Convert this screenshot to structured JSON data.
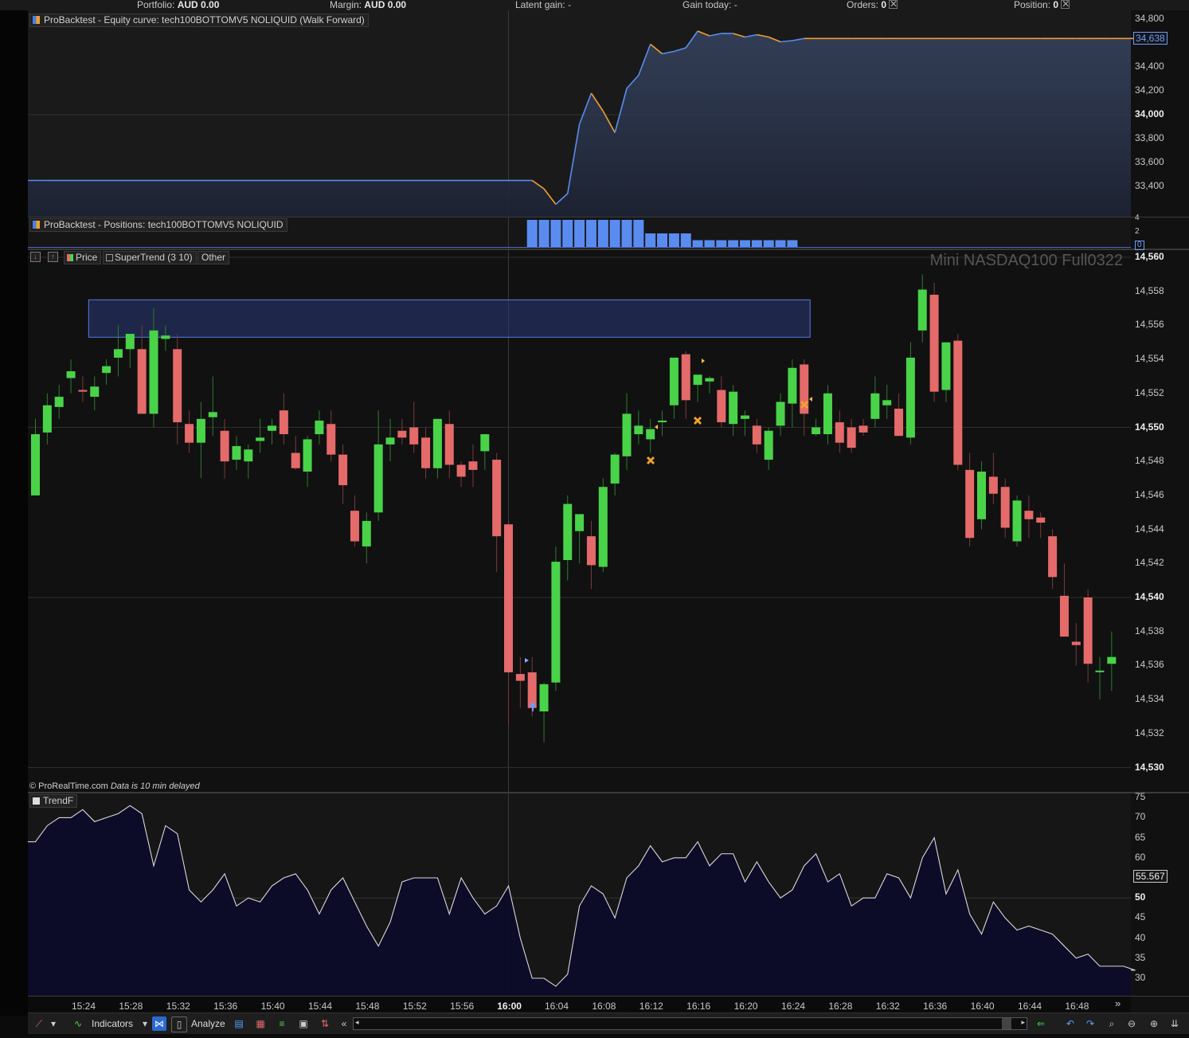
{
  "status_bar": {
    "portfolio_label": "Portfolio:",
    "portfolio_value": "AUD 0.00",
    "margin_label": "Margin:",
    "margin_value": "AUD 0.00",
    "latent_label": "Latent gain:",
    "latent_value": "-",
    "gain_today_label": "Gain today:",
    "gain_today_value": "-",
    "orders_label": "Orders:",
    "orders_value": "0",
    "position_label": "Position:",
    "position_value": "0"
  },
  "equity_panel": {
    "label": "ProBacktest - Equity curve: tech100BOTTOMV5 NOLIQUID (Walk Forward)",
    "axis_ticks": [
      "34,800",
      "34,638",
      "34,400",
      "34,200",
      "34,000",
      "33,800",
      "33,600",
      "33,400"
    ],
    "bold_tick": "34,000",
    "current_value": "34,638"
  },
  "positions_panel": {
    "label": "ProBacktest - Positions: tech100BOTTOMV5 NOLIQUID",
    "axis_ticks": [
      "4",
      "2",
      "0"
    ],
    "current_value": "0"
  },
  "price_panel": {
    "price_tag": "Price",
    "supertrend_tag": "SuperTrend (3 10)",
    "other_tag": "Other",
    "instrument": "Mini NASDAQ100 Full0322",
    "copyright": "© ProRealTime.com",
    "delay_note": "Data is 10 min delayed",
    "axis_ticks": [
      "14,560",
      "14,558",
      "14,556",
      "14,554",
      "14,552",
      "14,550",
      "14,548",
      "14,546",
      "14,544",
      "14,542",
      "14,540",
      "14,538",
      "14,536",
      "14,534",
      "14,532",
      "14,530"
    ],
    "bold_ticks": [
      "14,560",
      "14,550",
      "14,540",
      "14,530"
    ]
  },
  "trend_panel": {
    "label": "TrendF",
    "axis_ticks": [
      "75",
      "70",
      "65",
      "60",
      "55",
      "50",
      "45",
      "40",
      "35",
      "30"
    ],
    "bold_tick": "50",
    "current_value": "55.567"
  },
  "time_axis": {
    "labels": [
      "15:24",
      "15:28",
      "15:32",
      "15:36",
      "15:40",
      "15:44",
      "15:48",
      "15:52",
      "15:56",
      "16:00",
      "16:04",
      "16:08",
      "16:12",
      "16:16",
      "16:20",
      "16:24",
      "16:28",
      "16:32",
      "16:36",
      "16:40",
      "16:44",
      "16:48"
    ],
    "bold_label": "16:00"
  },
  "toolbar": {
    "indicators_label": "Indicators",
    "analyze_label": "Analyze"
  },
  "colors": {
    "bull": "#49d349",
    "bear": "#e56a6a",
    "equity_line": "#5a8cf0",
    "equity_flat": "#f0a030",
    "positions_bar": "#5a8cf0",
    "trend_line": "#d8d8d8",
    "zone": "#2a3a78"
  },
  "chart_data": [
    {
      "type": "line",
      "name": "equity_curve",
      "x_index": [
        0,
        1,
        2,
        3,
        4,
        5,
        6,
        7,
        8,
        9,
        10,
        11,
        12,
        13,
        14,
        15,
        16,
        17,
        18,
        19,
        20,
        21,
        22,
        23,
        24,
        25,
        26,
        27,
        28,
        29,
        30,
        31,
        32,
        33,
        34,
        35,
        36,
        37,
        38,
        39,
        40,
        41,
        42,
        43,
        44,
        45,
        46,
        47,
        48,
        49,
        50,
        51,
        52,
        53,
        54,
        55,
        56,
        57,
        58,
        59,
        60,
        61,
        62,
        63,
        64,
        65,
        66,
        67,
        68,
        69,
        70,
        71,
        72,
        73,
        74,
        75,
        76,
        77,
        78,
        79,
        80,
        81,
        82,
        83,
        84,
        85,
        86,
        87,
        88,
        89,
        90,
        91,
        92,
        93
      ],
      "values": [
        33450,
        33450,
        33450,
        33450,
        33450,
        33450,
        33450,
        33450,
        33450,
        33450,
        33450,
        33450,
        33450,
        33450,
        33450,
        33450,
        33450,
        33450,
        33450,
        33450,
        33450,
        33450,
        33450,
        33450,
        33450,
        33450,
        33450,
        33450,
        33450,
        33450,
        33450,
        33450,
        33450,
        33450,
        33450,
        33450,
        33450,
        33450,
        33450,
        33450,
        33450,
        33450,
        33450,
        33380,
        33250,
        33340,
        33920,
        34180,
        34030,
        33850,
        34220,
        34330,
        34590,
        34510,
        34530,
        34560,
        34700,
        34660,
        34680,
        34680,
        34650,
        34670,
        34650,
        34610,
        34620,
        34638,
        34638,
        34638,
        34638,
        34638,
        34638,
        34638,
        34638,
        34638,
        34638,
        34638,
        34638,
        34638,
        34638,
        34638,
        34638,
        34638,
        34638,
        34638,
        34638,
        34638,
        34638,
        34638,
        34638,
        34638,
        34638,
        34638,
        34638,
        34638
      ],
      "ylim": [
        33200,
        34800
      ]
    },
    {
      "type": "bar",
      "name": "positions",
      "x_index": [
        42,
        43,
        44,
        45,
        46,
        47,
        48,
        49,
        50,
        51,
        52,
        53,
        54,
        55,
        56,
        57,
        58,
        59,
        60,
        61,
        62,
        63,
        64
      ],
      "values": [
        4,
        4,
        4,
        4,
        4,
        4,
        4,
        4,
        4,
        4,
        2,
        2,
        2,
        2,
        1,
        1,
        1,
        1,
        1,
        1,
        1,
        1,
        1
      ],
      "ylim": [
        0,
        4
      ]
    },
    {
      "type": "candlestick",
      "name": "price",
      "ylim": [
        14529.5,
        14560.5
      ],
      "ohlc": [
        [
          14546,
          14550.5,
          14546,
          14549.6
        ],
        [
          14549.7,
          14552,
          14549,
          14551.3
        ],
        [
          14551.2,
          14552.5,
          14550.5,
          14551.8
        ],
        [
          14552.9,
          14554,
          14552,
          14553.3
        ],
        [
          14552.2,
          14553,
          14551.5,
          14552.1
        ],
        [
          14551.8,
          14553,
          14551,
          14552.4
        ],
        [
          14553.2,
          14554,
          14552.5,
          14553.6
        ],
        [
          14554.1,
          14556,
          14553,
          14554.6
        ],
        [
          14554.6,
          14555.5,
          14553.5,
          14555.5
        ],
        [
          14554.6,
          14556,
          14551.5,
          14550.8
        ],
        [
          14550.8,
          14557,
          14550,
          14555.7
        ],
        [
          14555.2,
          14556,
          14554.5,
          14555.4
        ],
        [
          14554.6,
          14555.5,
          14549,
          14550.3
        ],
        [
          14550.2,
          14551,
          14548.5,
          14549.1
        ],
        [
          14549.1,
          14551.5,
          14547,
          14550.5
        ],
        [
          14550.6,
          14553,
          14549.5,
          14550.9
        ],
        [
          14549.8,
          14550.5,
          14547,
          14548
        ],
        [
          14548.1,
          14549.5,
          14547.5,
          14548.9
        ],
        [
          14548,
          14549,
          14547,
          14548.7
        ],
        [
          14549.2,
          14550.5,
          14548.5,
          14549.4
        ],
        [
          14549.8,
          14550.5,
          14549,
          14550.1
        ],
        [
          14551,
          14552,
          14549,
          14549.6
        ],
        [
          14548.5,
          14549.5,
          14547.5,
          14547.6
        ],
        [
          14547.4,
          14549.5,
          14546.5,
          14549.3
        ],
        [
          14549.6,
          14551,
          14549,
          14550.4
        ],
        [
          14550.2,
          14551,
          14548,
          14548.4
        ],
        [
          14548.4,
          14549,
          14545.5,
          14546.6
        ],
        [
          14545.1,
          14546,
          14543,
          14543.3
        ],
        [
          14543,
          14545,
          14542,
          14544.5
        ],
        [
          14545,
          14551,
          14544.5,
          14549
        ],
        [
          14549,
          14550.5,
          14548,
          14549.4
        ],
        [
          14549.8,
          14550.5,
          14549,
          14549.4
        ],
        [
          14550,
          14551.5,
          14548.5,
          14549
        ],
        [
          14549.4,
          14550,
          14547,
          14547.6
        ],
        [
          14547.6,
          14550.5,
          14547,
          14550.5
        ],
        [
          14550.2,
          14551,
          14547,
          14547.8
        ],
        [
          14547.8,
          14548,
          14546.5,
          14547.1
        ],
        [
          14548,
          14549,
          14546.5,
          14547.5
        ],
        [
          14548.6,
          14549.5,
          14547.5,
          14549.6
        ],
        [
          14548.1,
          14548.5,
          14541.5,
          14543.6
        ],
        [
          14544.3,
          14544.5,
          14532.5,
          14535.6
        ],
        [
          14535.5,
          14536.5,
          14533.5,
          14535.1
        ],
        [
          14535.6,
          14536.5,
          14533,
          14533.5
        ],
        [
          14533.3,
          14535,
          14531.5,
          14534.9
        ],
        [
          14535,
          14543,
          14534.5,
          14542.1
        ],
        [
          14542.2,
          14546,
          14541,
          14545.5
        ],
        [
          14543.9,
          14544.5,
          14542,
          14544.9
        ],
        [
          14543.6,
          14544.5,
          14540.5,
          14541.9
        ],
        [
          14541.8,
          14547,
          14541.5,
          14546.5
        ],
        [
          14546.7,
          14548.5,
          14546,
          14548.4
        ],
        [
          14548.3,
          14552,
          14547.5,
          14550.8
        ],
        [
          14549.6,
          14551,
          14549,
          14550.1
        ],
        [
          14549.3,
          14550.5,
          14548.5,
          14549.9
        ],
        [
          14550.3,
          14551,
          14549.5,
          14550.4
        ],
        [
          14551.3,
          14553.5,
          14550.5,
          14554.1
        ],
        [
          14554.3,
          14554.5,
          14550.5,
          14551.6
        ],
        [
          14552.5,
          14553,
          14551.5,
          14553.1
        ],
        [
          14552.7,
          14553,
          14552,
          14552.9
        ],
        [
          14552.2,
          14553,
          14550,
          14550.3
        ],
        [
          14550.2,
          14552.5,
          14549.5,
          14552.1
        ],
        [
          14550.5,
          14551,
          14549.5,
          14550.7
        ],
        [
          14550.1,
          14550.5,
          14548.5,
          14549
        ],
        [
          14548.1,
          14550,
          14547.5,
          14549.8
        ],
        [
          14550.1,
          14552,
          14549.5,
          14551.5
        ],
        [
          14551.4,
          14554,
          14550,
          14553.5
        ],
        [
          14553.7,
          14554,
          14549.5,
          14550.8
        ],
        [
          14549.6,
          14550.5,
          14549.5,
          14550
        ],
        [
          14549.6,
          14552.5,
          14549,
          14552
        ],
        [
          14550.3,
          14551,
          14548.5,
          14549.1
        ],
        [
          14550,
          14550.5,
          14548.5,
          14548.8
        ],
        [
          14550.1,
          14550.5,
          14549.5,
          14549.7
        ],
        [
          14550.5,
          14553,
          14550,
          14552
        ],
        [
          14551.3,
          14552.5,
          14550.5,
          14551.6
        ],
        [
          14551.1,
          14552,
          14549.5,
          14549.5
        ],
        [
          14549.4,
          14555,
          14549,
          14554.1
        ],
        [
          14555.7,
          14559,
          14555,
          14558.1
        ],
        [
          14557.8,
          14558.5,
          14551.5,
          14552.1
        ],
        [
          14552.2,
          14555,
          14551.5,
          14555
        ],
        [
          14555.1,
          14555.5,
          14547.5,
          14547.8
        ],
        [
          14547.5,
          14548.5,
          14543,
          14543.5
        ],
        [
          14544.6,
          14548,
          14544,
          14547.4
        ],
        [
          14547.1,
          14548.5,
          14545.5,
          14546.1
        ],
        [
          14546.5,
          14547,
          14543.5,
          14544.1
        ],
        [
          14543.3,
          14546,
          14543,
          14545.7
        ],
        [
          14545.1,
          14546,
          14543.5,
          14544.6
        ],
        [
          14544.7,
          14545,
          14543.5,
          14544.4
        ],
        [
          14543.6,
          14544,
          14540.5,
          14541.2
        ],
        [
          14540.1,
          14542,
          14538,
          14537.7
        ],
        [
          14537.4,
          14538.5,
          14536,
          14537.2
        ],
        [
          14540,
          14540.5,
          14535,
          14536.1
        ],
        [
          14535.7,
          14536.5,
          14534,
          14535.7
        ],
        [
          14536.1,
          14538,
          14534.5,
          14536.5
        ]
      ],
      "zone": {
        "x_start": 4.5,
        "x_end": 65.5,
        "y_low": 14555.3,
        "y_high": 14557.5
      }
    },
    {
      "type": "line",
      "name": "TrendF",
      "values": [
        64,
        68,
        70,
        70,
        72,
        69,
        70,
        71,
        73,
        71,
        58,
        68,
        66,
        52,
        49,
        52,
        56,
        48,
        50,
        49,
        53,
        55,
        56,
        52,
        46,
        52,
        55,
        49,
        43,
        38,
        44,
        54,
        55,
        55,
        55,
        46,
        55,
        50,
        46,
        48,
        53,
        40,
        30,
        30,
        28,
        31,
        48,
        53,
        51,
        45,
        55,
        58,
        63,
        59,
        60,
        60,
        64,
        58,
        61,
        61,
        54,
        59,
        54,
        50,
        52,
        58,
        61,
        54,
        56,
        48,
        50,
        50,
        56,
        55,
        50,
        60,
        65,
        51,
        57,
        46,
        41,
        49,
        45,
        42,
        43,
        42,
        41,
        38,
        35,
        36,
        33,
        33,
        33,
        32
      ],
      "ylim": [
        27,
        76
      ]
    }
  ]
}
